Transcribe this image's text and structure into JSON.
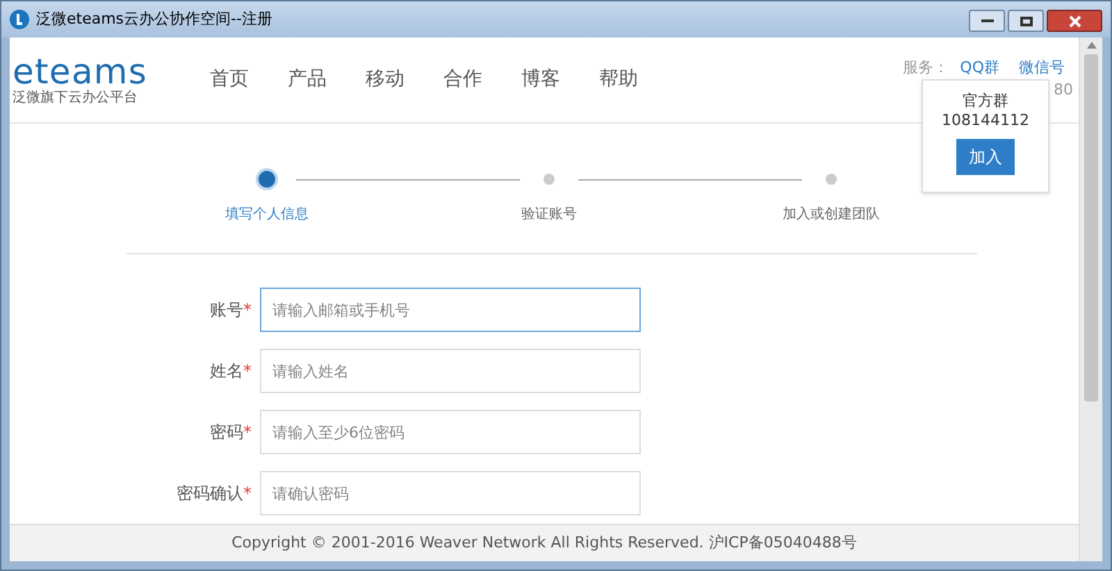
{
  "window": {
    "title": "泛微eteams云办公协作空间--注册"
  },
  "logo": {
    "name": "eteams",
    "tagline": "泛微旗下云办公平台"
  },
  "nav": [
    {
      "label": "首页"
    },
    {
      "label": "产品"
    },
    {
      "label": "移动"
    },
    {
      "label": "合作"
    },
    {
      "label": "博客"
    },
    {
      "label": "帮助"
    }
  ],
  "service": {
    "label": "服务：",
    "links": [
      "QQ群",
      "微信号"
    ],
    "phone_tail": "80"
  },
  "popup": {
    "title": "官方群",
    "number": "108144112",
    "button": "加入"
  },
  "steps": [
    {
      "label": "填写个人信息",
      "selected": true
    },
    {
      "label": "验证账号",
      "selected": false
    },
    {
      "label": "加入或创建团队",
      "selected": false
    }
  ],
  "fields": [
    {
      "label": "账号",
      "required_mark": "*",
      "placeholder": "请输入邮箱或手机号",
      "focused": true
    },
    {
      "label": "姓名",
      "required_mark": "*",
      "placeholder": "请输入姓名",
      "focused": false
    },
    {
      "label": "密码",
      "required_mark": "*",
      "placeholder": "请输入至少6位密码",
      "focused": false
    },
    {
      "label": "密码确认",
      "required_mark": "*",
      "placeholder": "请确认密码",
      "focused": false
    }
  ],
  "footer": "Copyright © 2001-2016 Weaver Network All Rights Reserved. 沪ICP备05040488号"
}
